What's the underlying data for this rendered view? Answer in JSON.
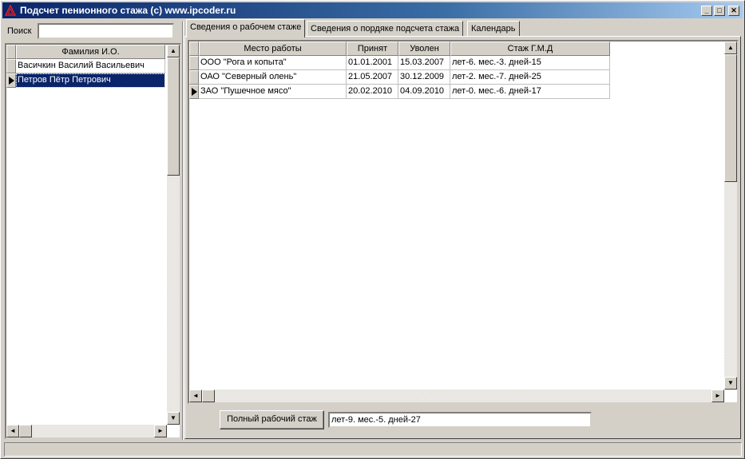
{
  "window": {
    "title": "Подсчет пенионного стажа (c) www.ipcoder.ru",
    "minimize_glyph": "_",
    "maximize_glyph": "□",
    "close_glyph": "✕"
  },
  "search": {
    "label": "Поиск",
    "value": ""
  },
  "people": {
    "header": "Фамилия И.О.",
    "rows": [
      "Васичкин Василий Васильевич",
      "Петров Пётр Петрович"
    ],
    "selected_index": 1
  },
  "tabs": [
    "Сведения о рабочем стаже",
    "Сведения о пордяке подсчета стажа",
    "Календарь"
  ],
  "active_tab": 0,
  "jobs": {
    "headers": [
      "Место работы",
      "Принят",
      "Уволен",
      "Стаж Г.М.Д"
    ],
    "rows": [
      [
        "ООО \"Рога и копыта\"",
        "01.01.2001",
        "15.03.2007",
        "лет-6. мес.-3. дней-15"
      ],
      [
        "ОАО \"Северный олень\"",
        "21.05.2007",
        "30.12.2009",
        "лет-2. мес.-7. дней-25"
      ],
      [
        "ЗАО \"Пушечное мясо\"",
        "20.02.2010",
        "04.09.2010",
        "лет-0. мес.-6. дней-17"
      ]
    ],
    "current_row": 2
  },
  "total": {
    "button_label": "Полный рабочий стаж",
    "value": "лет-9. мес.-5. дней-27"
  },
  "colors": {
    "titlebar": "#0a246a",
    "selection": "#0a246a",
    "face": "#d4d0c8"
  },
  "icons": [
    "app-icon",
    "row-pointer-icon",
    "scroll-up-icon",
    "scroll-down-icon",
    "scroll-left-icon",
    "scroll-right-icon"
  ]
}
